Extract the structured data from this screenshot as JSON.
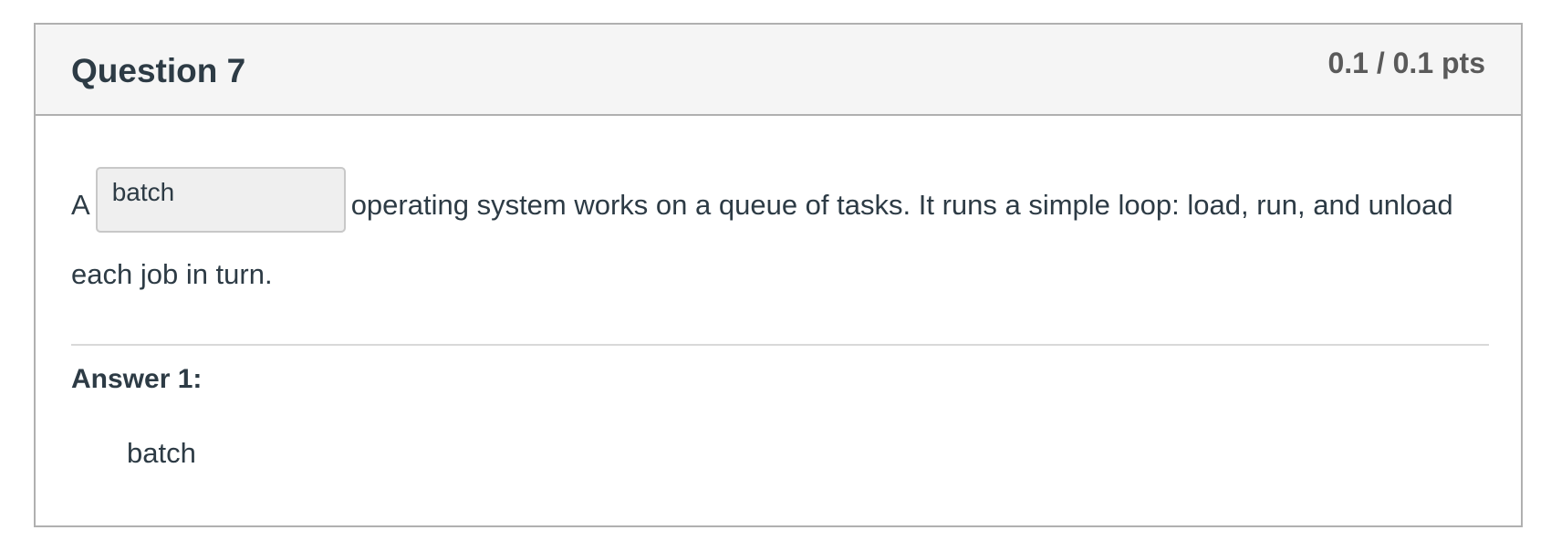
{
  "question": {
    "title": "Question 7",
    "points": "0.1 / 0.1 pts",
    "text_before": "A",
    "blank_value": "batch",
    "text_after": "operating system works on a queue of tasks. It runs a simple loop: load, run, and unload each job in turn."
  },
  "answers": [
    {
      "label": "Answer 1:",
      "value": "batch"
    }
  ]
}
